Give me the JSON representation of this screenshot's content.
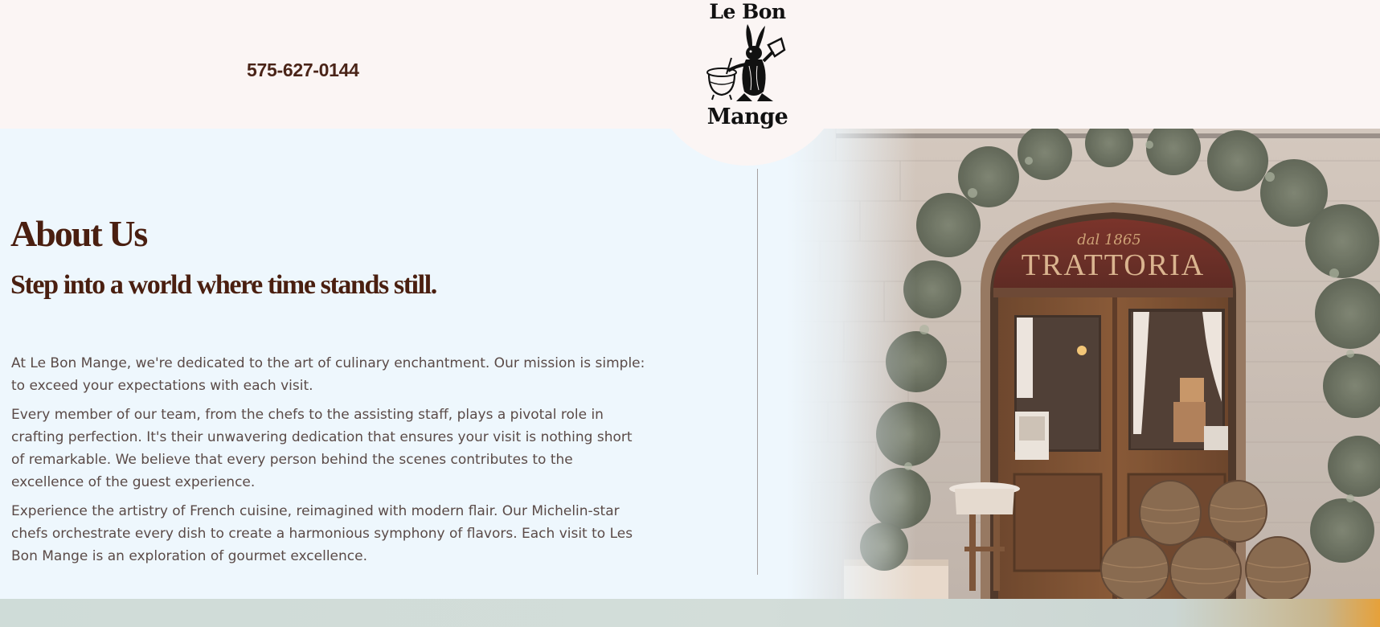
{
  "header": {
    "phone": "575-627-0144"
  },
  "logo": {
    "line1": "Le Bon",
    "line2": "Mange",
    "icon": "rabbit-chef-icon"
  },
  "about": {
    "title": "About Us",
    "subtitle": "Step into a world where time stands still.",
    "paragraphs": [
      "At Le Bon Mange, we're dedicated to the art of culinary enchantment. Our mission is simple: to exceed your expectations with each visit.",
      "Every member of our team, from the chefs to the assisting staff, plays a pivotal role in crafting perfection. It's their unwavering dedication that ensures your visit is nothing short of remarkable. We believe that every person behind the scenes contributes to the excellence of the guest experience.",
      "Experience the artistry of French cuisine, reimagined with modern flair. Our Michelin-star chefs orchestrate every dish to create a harmonious symphony of flavors. Each visit to Les Bon Mange is an exploration of gourmet excellence."
    ]
  },
  "photo": {
    "sign_small": "dal 1865",
    "sign_large": "TRATTORIA"
  },
  "colors": {
    "brand_brown": "#4a1f10",
    "header_bg": "#fbf5f4",
    "about_bg": "#eef7fd",
    "body_text": "#5a4a47"
  }
}
